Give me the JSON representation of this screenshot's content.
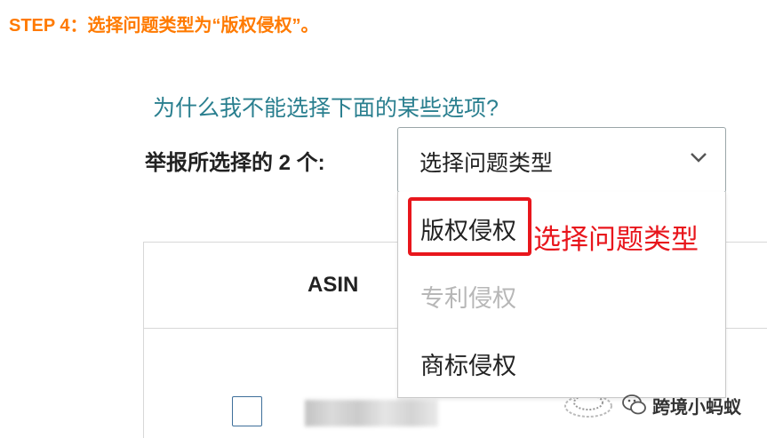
{
  "step_title": "STEP 4：选择问题类型为“版权侵权”。",
  "help_link": "为什么我不能选择下面的某些选项?",
  "report_label": "举报所选择的 2 个:",
  "select": {
    "value": "选择问题类型"
  },
  "options": [
    {
      "label": "版权侵权",
      "disabled": false
    },
    {
      "label": "专利侵权",
      "disabled": true
    },
    {
      "label": "商标侵权",
      "disabled": false
    }
  ],
  "table": {
    "header_asin": "ASIN"
  },
  "annotation": "选择问题类型",
  "watermark": "跨境小蚂蚁",
  "colors": {
    "step_title": "#ff7a00",
    "link": "#2a7f8f",
    "highlight": "#e8161c",
    "disabled_text": "#b7b7b7"
  }
}
